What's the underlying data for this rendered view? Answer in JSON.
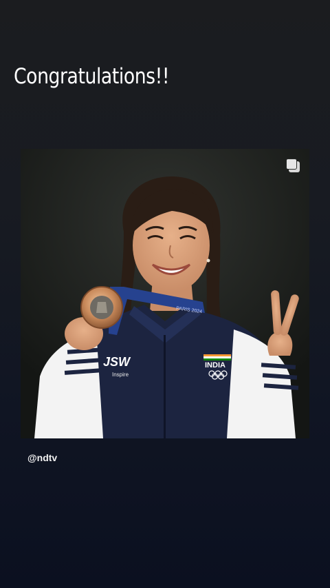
{
  "story": {
    "caption": "Congratulations!!"
  },
  "post": {
    "image_alt": "Athlete smiling with bronze medal and victory sign",
    "jacket_brand": "JSW",
    "jacket_brand_sub": "Inspire",
    "jacket_country": "INDIA",
    "lanyard_text": "PARIS 2024",
    "multi_icon": "carousel-icon"
  },
  "mention": {
    "handle": "@ndtv"
  },
  "colors": {
    "background_top": "#1b1c1f",
    "background_bottom": "#0b1020",
    "jacket_navy": "#1c2440",
    "medal_bronze": "#c8895a"
  }
}
